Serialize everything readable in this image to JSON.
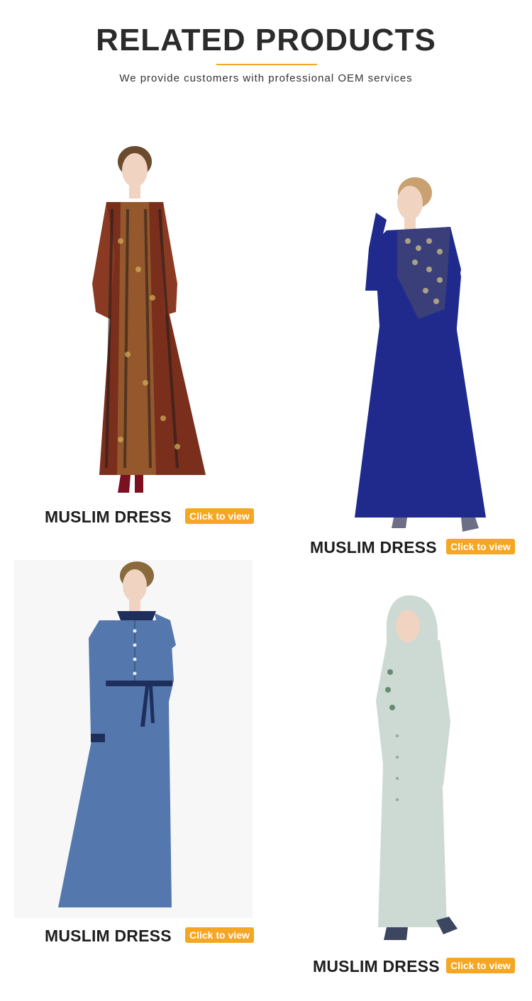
{
  "header": {
    "title": "RELATED PRODUCTS",
    "subtitle": "We provide customers with professional OEM services"
  },
  "products": [
    {
      "name": "MUSLIM DRESS",
      "button": "Click to view",
      "colors": {
        "dress": "#7a2e1c",
        "accent": "#c9a24a"
      }
    },
    {
      "name": "MUSLIM DRESS",
      "button": "Click to view",
      "colors": {
        "dress": "#1f2a8c",
        "accent": "#c7b98a"
      }
    },
    {
      "name": "MUSLIM DRESS",
      "button": "Click to view",
      "colors": {
        "dress": "#5478ad",
        "accent": "#1f2f5c"
      }
    },
    {
      "name": "MUSLIM DRESS",
      "button": "Click to view",
      "colors": {
        "dress": "#cdd9d3",
        "accent": "#4a7a5a"
      }
    }
  ],
  "colors": {
    "accent": "#f5a623",
    "title": "#2b2b2b"
  }
}
